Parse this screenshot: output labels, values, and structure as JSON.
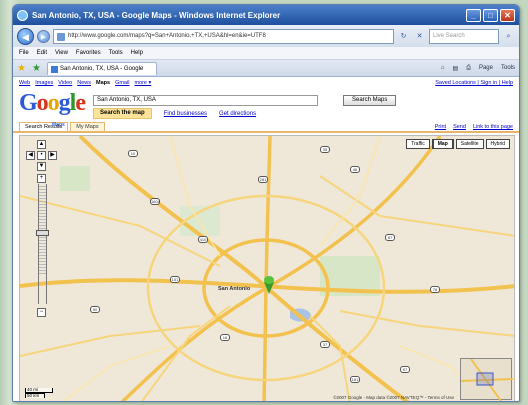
{
  "window": {
    "title": "San Antonio, TX, USA - Google Maps - Windows Internet Explorer",
    "minimize": "_",
    "maximize": "□",
    "close": "✕"
  },
  "addressbar": {
    "url": "http://www.google.com/maps?q=San+Antonio,+TX,+USA&hl=en&ie=UTF8",
    "search_placeholder": "Live Search"
  },
  "menu": [
    "File",
    "Edit",
    "View",
    "Favorites",
    "Tools",
    "Help"
  ],
  "tab": {
    "label": "San Antonio, TX, USA - Google Maps"
  },
  "toolbar_right": [
    "Page",
    "Tools"
  ],
  "google_top": {
    "links": [
      "Web",
      "Images",
      "Video",
      "News",
      "Maps",
      "Gmail",
      "more ▾"
    ],
    "right": "Saved Locations | Sign in | Help"
  },
  "logo": {
    "sub": "Maps"
  },
  "search": {
    "query": "San Antonio, TX, USA",
    "button": "Search Maps",
    "options": [
      "Search the map",
      "Find businesses",
      "Get directions"
    ]
  },
  "subtabs": [
    "Search Results",
    "My Maps"
  ],
  "links": [
    "Print",
    "Send",
    "Link to this page"
  ],
  "map": {
    "types": [
      "Traffic",
      "Map",
      "Satellite",
      "Hybrid"
    ],
    "city_label": "San Antonio",
    "scale": [
      "40 mi",
      "50 km"
    ],
    "copyright": "©2007 Google - Map data ©2007 NAVTEQ™ - Terms of Use",
    "highways": [
      "10",
      "35",
      "281",
      "410",
      "87",
      "16",
      "151",
      "90",
      "1604",
      "37",
      "181",
      "46",
      "78",
      "97"
    ]
  },
  "colors": {
    "accent": "#e8b66a",
    "link": "#0000cc",
    "road": "#f2c14e",
    "pin": "#3a9a2a"
  }
}
